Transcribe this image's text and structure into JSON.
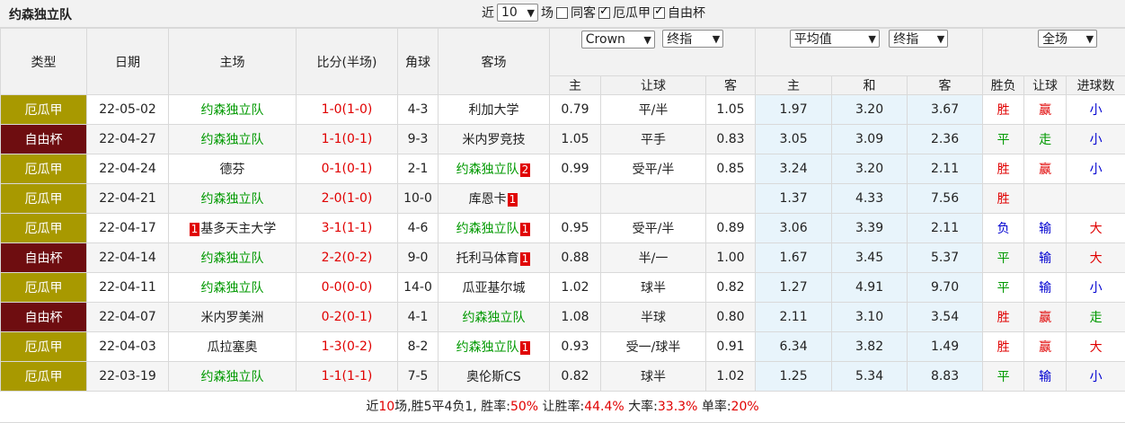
{
  "team_name": "约森独立队",
  "filters": {
    "recent_label": "近",
    "count_value": "10",
    "count_suffix": "场",
    "same_guest_label": "同客",
    "same_guest_checked": false,
    "comp_a_label": "厄瓜甲",
    "comp_a_checked": true,
    "comp_b_label": "自由杯",
    "comp_b_checked": true
  },
  "headers": {
    "type": "类型",
    "date": "日期",
    "home": "主场",
    "score": "比分(半场)",
    "corners": "角球",
    "away": "客场",
    "company": "Crown",
    "handicap_kind": "终指",
    "avg_kind": "平均值",
    "avg_handicap_kind": "终指",
    "scope": "全场",
    "wdl": "胜负",
    "ah_result": "让球",
    "ou_result": "进球数",
    "sub_home": "主",
    "sub_line": "让球",
    "sub_away": "客",
    "sub_e_home": "主",
    "sub_e_draw": "和",
    "sub_e_away": "客"
  },
  "colors": {
    "comp_a_bg": "#a89900",
    "comp_b_bg": "#6e0d10",
    "team_green": "#009900",
    "result_red": "#e00000",
    "result_blue": "#0000d0"
  },
  "matches": [
    {
      "comp": "厄瓜甲",
      "comp_key": "a",
      "date": "22-05-02",
      "home": "约森独立队",
      "home_focus": true,
      "home_card": "",
      "score": "1-0(1-0)",
      "corners": "4-3",
      "away": "利加大学",
      "away_focus": false,
      "away_card": "",
      "o_home": "0.79",
      "o_line": "平/半",
      "o_away": "1.05",
      "e_home": "1.97",
      "e_draw": "3.20",
      "e_away": "3.67",
      "wdl": "胜",
      "wdl_c": "red",
      "ah": "赢",
      "ah_c": "red",
      "ou": "小",
      "ou_c": "blue"
    },
    {
      "comp": "自由杯",
      "comp_key": "b",
      "date": "22-04-27",
      "home": "约森独立队",
      "home_focus": true,
      "home_card": "",
      "score": "1-1(0-1)",
      "corners": "9-3",
      "away": "米内罗竞技",
      "away_focus": false,
      "away_card": "",
      "o_home": "1.05",
      "o_line": "平手",
      "o_away": "0.83",
      "e_home": "3.05",
      "e_draw": "3.09",
      "e_away": "2.36",
      "wdl": "平",
      "wdl_c": "green",
      "ah": "走",
      "ah_c": "green",
      "ou": "小",
      "ou_c": "blue"
    },
    {
      "comp": "厄瓜甲",
      "comp_key": "a",
      "date": "22-04-24",
      "home": "德芬",
      "home_focus": false,
      "home_card": "",
      "score": "0-1(0-1)",
      "corners": "2-1",
      "away": "约森独立队",
      "away_focus": true,
      "away_card": "2",
      "o_home": "0.99",
      "o_line": "受平/半",
      "o_away": "0.85",
      "e_home": "3.24",
      "e_draw": "3.20",
      "e_away": "2.11",
      "wdl": "胜",
      "wdl_c": "red",
      "ah": "赢",
      "ah_c": "red",
      "ou": "小",
      "ou_c": "blue"
    },
    {
      "comp": "厄瓜甲",
      "comp_key": "a",
      "date": "22-04-21",
      "home": "约森独立队",
      "home_focus": true,
      "home_card": "",
      "score": "2-0(1-0)",
      "corners": "10-0",
      "away": "库恩卡",
      "away_focus": false,
      "away_card": "1",
      "o_home": "",
      "o_line": "",
      "o_away": "",
      "e_home": "1.37",
      "e_draw": "4.33",
      "e_away": "7.56",
      "wdl": "胜",
      "wdl_c": "red",
      "ah": "",
      "ah_c": "red",
      "ou": "",
      "ou_c": "blue"
    },
    {
      "comp": "厄瓜甲",
      "comp_key": "a",
      "date": "22-04-17",
      "home": "基多天主大学",
      "home_focus": false,
      "home_card": "1",
      "score": "3-1(1-1)",
      "corners": "4-6",
      "away": "约森独立队",
      "away_focus": true,
      "away_card": "1",
      "o_home": "0.95",
      "o_line": "受平/半",
      "o_away": "0.89",
      "e_home": "3.06",
      "e_draw": "3.39",
      "e_away": "2.11",
      "wdl": "负",
      "wdl_c": "blue",
      "ah": "输",
      "ah_c": "blue",
      "ou": "大",
      "ou_c": "red"
    },
    {
      "comp": "自由杯",
      "comp_key": "b",
      "date": "22-04-14",
      "home": "约森独立队",
      "home_focus": true,
      "home_card": "",
      "score": "2-2(0-2)",
      "corners": "9-0",
      "away": "托利马体育",
      "away_focus": false,
      "away_card": "1",
      "o_home": "0.88",
      "o_line": "半/一",
      "o_away": "1.00",
      "e_home": "1.67",
      "e_draw": "3.45",
      "e_away": "5.37",
      "wdl": "平",
      "wdl_c": "green",
      "ah": "输",
      "ah_c": "blue",
      "ou": "大",
      "ou_c": "red"
    },
    {
      "comp": "厄瓜甲",
      "comp_key": "a",
      "date": "22-04-11",
      "home": "约森独立队",
      "home_focus": true,
      "home_card": "",
      "score": "0-0(0-0)",
      "corners": "14-0",
      "away": "瓜亚基尔城",
      "away_focus": false,
      "away_card": "",
      "o_home": "1.02",
      "o_line": "球半",
      "o_away": "0.82",
      "e_home": "1.27",
      "e_draw": "4.91",
      "e_away": "9.70",
      "wdl": "平",
      "wdl_c": "green",
      "ah": "输",
      "ah_c": "blue",
      "ou": "小",
      "ou_c": "blue"
    },
    {
      "comp": "自由杯",
      "comp_key": "b",
      "date": "22-04-07",
      "home": "米内罗美洲",
      "home_focus": false,
      "home_card": "",
      "score": "0-2(0-1)",
      "corners": "4-1",
      "away": "约森独立队",
      "away_focus": true,
      "away_card": "",
      "o_home": "1.08",
      "o_line": "半球",
      "o_away": "0.80",
      "e_home": "2.11",
      "e_draw": "3.10",
      "e_away": "3.54",
      "wdl": "胜",
      "wdl_c": "red",
      "ah": "赢",
      "ah_c": "red",
      "ou": "走",
      "ou_c": "green"
    },
    {
      "comp": "厄瓜甲",
      "comp_key": "a",
      "date": "22-04-03",
      "home": "瓜拉塞奥",
      "home_focus": false,
      "home_card": "",
      "score": "1-3(0-2)",
      "corners": "8-2",
      "away": "约森独立队",
      "away_focus": true,
      "away_card": "1",
      "o_home": "0.93",
      "o_line": "受一/球半",
      "o_away": "0.91",
      "e_home": "6.34",
      "e_draw": "3.82",
      "e_away": "1.49",
      "wdl": "胜",
      "wdl_c": "red",
      "ah": "赢",
      "ah_c": "red",
      "ou": "大",
      "ou_c": "red"
    },
    {
      "comp": "厄瓜甲",
      "comp_key": "a",
      "date": "22-03-19",
      "home": "约森独立队",
      "home_focus": true,
      "home_card": "",
      "score": "1-1(1-1)",
      "corners": "7-5",
      "away": "奥伦斯CS",
      "away_focus": false,
      "away_card": "",
      "o_home": "0.82",
      "o_line": "球半",
      "o_away": "1.02",
      "e_home": "1.25",
      "e_draw": "5.34",
      "e_away": "8.83",
      "wdl": "平",
      "wdl_c": "green",
      "ah": "输",
      "ah_c": "blue",
      "ou": "小",
      "ou_c": "blue"
    }
  ],
  "summary": {
    "prefix": "近",
    "count": "10",
    "record": "场,胜5平4负1,",
    "win_rate_label": " 胜率:",
    "win_rate": "50%",
    "ah_rate_label": " 让胜率:",
    "ah_rate": "44.4%",
    "over_rate_label": " 大率:",
    "over_rate": "33.3%",
    "odd_rate_label": " 单率:",
    "odd_rate": "20%"
  }
}
